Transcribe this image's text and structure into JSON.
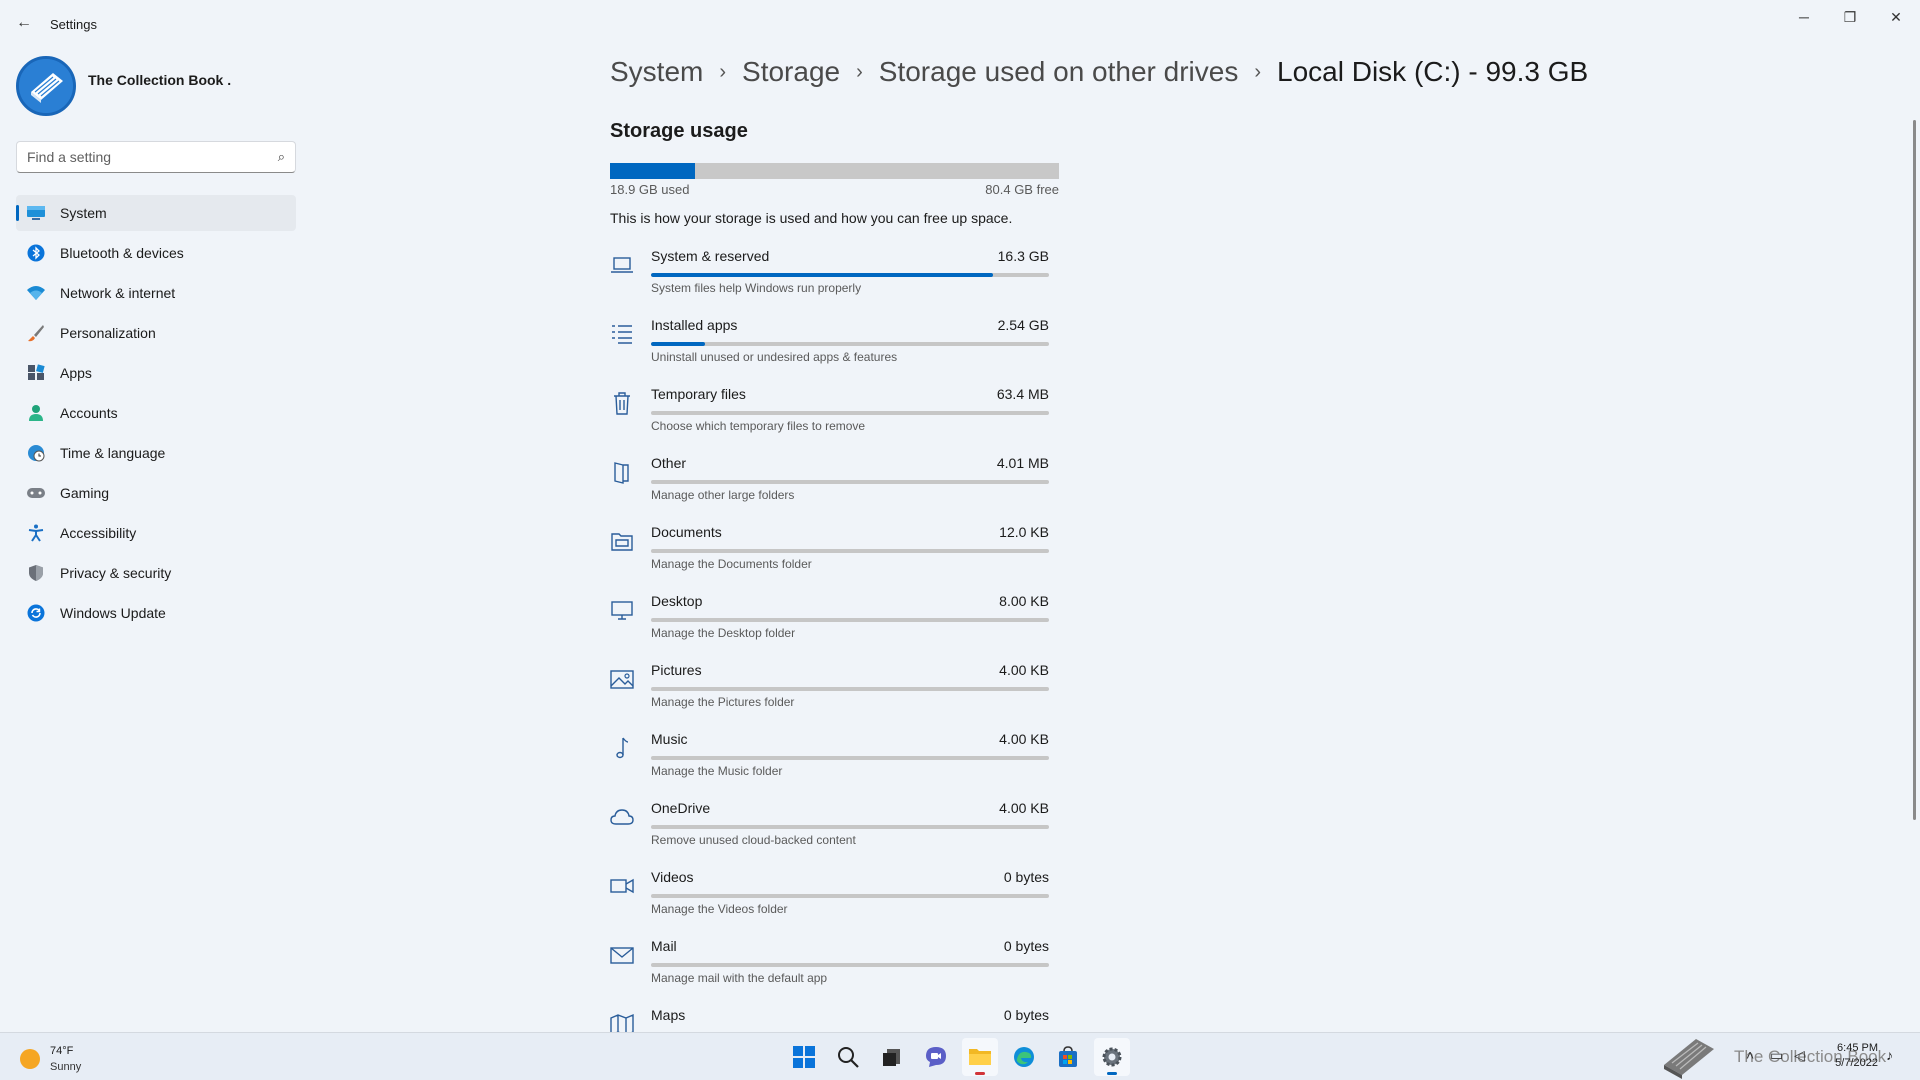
{
  "window": {
    "title": "Settings",
    "back_icon": "←",
    "minimize_icon": "─",
    "restore_icon": "❐",
    "close_icon": "✕"
  },
  "profile": {
    "name": "The Collection Book ."
  },
  "search": {
    "placeholder": "Find a setting",
    "icon": "⌕"
  },
  "nav": [
    {
      "label": "System",
      "icon": "monitor-icon",
      "active": true
    },
    {
      "label": "Bluetooth & devices",
      "icon": "bluetooth-icon"
    },
    {
      "label": "Network & internet",
      "icon": "wifi-icon"
    },
    {
      "label": "Personalization",
      "icon": "brush-icon"
    },
    {
      "label": "Apps",
      "icon": "apps-icon"
    },
    {
      "label": "Accounts",
      "icon": "person-icon"
    },
    {
      "label": "Time & language",
      "icon": "globe-clock-icon"
    },
    {
      "label": "Gaming",
      "icon": "gamepad-icon"
    },
    {
      "label": "Accessibility",
      "icon": "accessibility-icon"
    },
    {
      "label": "Privacy & security",
      "icon": "shield-icon"
    },
    {
      "label": "Windows Update",
      "icon": "update-icon"
    }
  ],
  "breadcrumb": {
    "items": [
      "System",
      "Storage",
      "Storage used on other drives",
      "Local Disk (C:) - 99.3 GB"
    ],
    "separator": "›"
  },
  "storage": {
    "section_title": "Storage usage",
    "used_fraction": 0.19,
    "used_label": "18.9 GB used",
    "free_label": "80.4 GB free",
    "description": "This is how your storage is used and how you can free up space."
  },
  "categories": [
    {
      "name": "System & reserved",
      "size": "16.3 GB",
      "desc": "System files help Windows run properly",
      "fraction": 0.86,
      "icon": "laptop-icon"
    },
    {
      "name": "Installed apps",
      "size": "2.54 GB",
      "desc": "Uninstall unused or undesired apps & features",
      "fraction": 0.135,
      "icon": "list-icon"
    },
    {
      "name": "Temporary files",
      "size": "63.4 MB",
      "desc": "Choose which temporary files to remove",
      "fraction": 0.0,
      "icon": "trash-icon"
    },
    {
      "name": "Other",
      "size": "4.01 MB",
      "desc": "Manage other large folders",
      "fraction": 0.0,
      "icon": "folder-icon"
    },
    {
      "name": "Documents",
      "size": "12.0 KB",
      "desc": "Manage the Documents folder",
      "fraction": 0.0,
      "icon": "documents-icon"
    },
    {
      "name": "Desktop",
      "size": "8.00 KB",
      "desc": "Manage the Desktop folder",
      "fraction": 0.0,
      "icon": "desktop-icon"
    },
    {
      "name": "Pictures",
      "size": "4.00 KB",
      "desc": "Manage the Pictures folder",
      "fraction": 0.0,
      "icon": "picture-icon"
    },
    {
      "name": "Music",
      "size": "4.00 KB",
      "desc": "Manage the Music folder",
      "fraction": 0.0,
      "icon": "music-icon"
    },
    {
      "name": "OneDrive",
      "size": "4.00 KB",
      "desc": "Remove unused cloud-backed content",
      "fraction": 0.0,
      "icon": "cloud-icon"
    },
    {
      "name": "Videos",
      "size": "0 bytes",
      "desc": "Manage the Videos folder",
      "fraction": 0.0,
      "icon": "video-icon"
    },
    {
      "name": "Mail",
      "size": "0 bytes",
      "desc": "Manage mail with the default app",
      "fraction": 0.0,
      "icon": "mail-icon"
    },
    {
      "name": "Maps",
      "size": "0 bytes",
      "desc": "",
      "fraction": 0.0,
      "icon": "map-icon"
    }
  ],
  "taskbar": {
    "weather_temp": "74°F",
    "weather_cond": "Sunny",
    "apps": [
      "windows-start-icon",
      "search-icon",
      "task-view-icon",
      "teams-chat-icon",
      "file-explorer-icon",
      "edge-icon",
      "store-icon",
      "settings-icon"
    ],
    "watermark": "The Collection Book",
    "time": "6:45 PM",
    "date": "5/7/2022"
  },
  "colors": {
    "accent": "#0067c0",
    "background": "#f0f4f9",
    "bar_track": "#c6c6c6"
  }
}
